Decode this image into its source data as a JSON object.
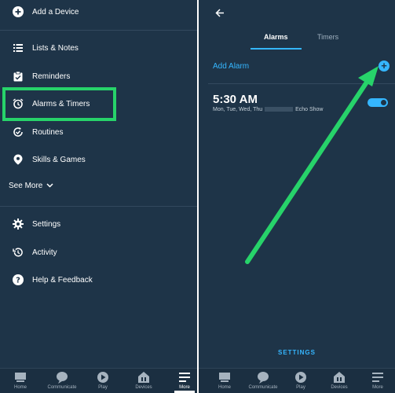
{
  "left_menu": {
    "add_device": "Add a Device",
    "items": [
      {
        "label": "Lists & Notes",
        "icon": "list-icon"
      },
      {
        "label": "Reminders",
        "icon": "reminder-icon"
      },
      {
        "label": "Alarms & Timers",
        "icon": "alarm-clock-icon"
      },
      {
        "label": "Routines",
        "icon": "routines-icon"
      },
      {
        "label": "Skills & Games",
        "icon": "location-pin-icon"
      }
    ],
    "see_more": "See More",
    "settings_items": [
      {
        "label": "Settings",
        "icon": "gear-icon"
      },
      {
        "label": "Activity",
        "icon": "history-icon"
      },
      {
        "label": "Help & Feedback",
        "icon": "help-icon"
      }
    ]
  },
  "bottom_nav": {
    "items": [
      {
        "label": "Home"
      },
      {
        "label": "Communicate"
      },
      {
        "label": "Play"
      },
      {
        "label": "Devices"
      },
      {
        "label": "More"
      }
    ]
  },
  "alarms_screen": {
    "tabs": [
      "Alarms",
      "Timers"
    ],
    "add_alarm": "Add Alarm",
    "alarm": {
      "time": "5:30 AM",
      "days": "Mon, Tue, Wed, Thu",
      "device": "Echo Show",
      "enabled": true
    },
    "settings_link": "SETTINGS"
  },
  "colors": {
    "background": "#1e3448",
    "accent": "#35b6ff",
    "highlight": "#27d36a",
    "annotation_arrow": "#27d36a"
  }
}
